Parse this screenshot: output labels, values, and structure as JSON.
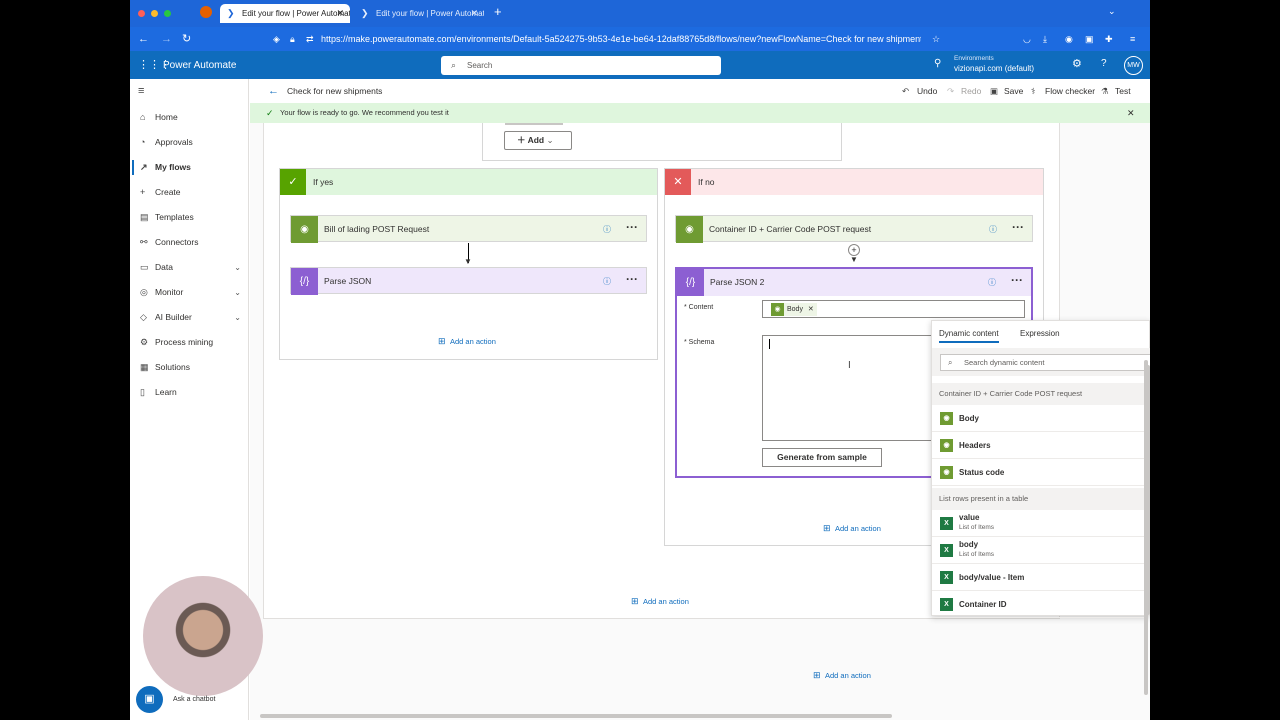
{
  "browser": {
    "tabs": [
      {
        "label": "Edit your flow | Power Automate",
        "active": true
      },
      {
        "label": "Edit your flow | Power Automate",
        "active": false
      }
    ],
    "new_tab": "+",
    "url": "https://make.powerautomate.com/environments/Default-5a524275-9b53-4e1e-be64-12daf88765d8/flows/new?newFlowName=Check for new shipments&"
  },
  "app": {
    "name": "Power Automate",
    "search_placeholder": "Search",
    "env_label": "Environments",
    "env_name": "vizionapi.com (default)",
    "avatar": "MW"
  },
  "sidebar": {
    "items": [
      {
        "label": "Home",
        "icon": "home-icon",
        "glyph": "⌂"
      },
      {
        "label": "Approvals",
        "icon": "approvals-icon",
        "glyph": "◔"
      },
      {
        "label": "My flows",
        "icon": "flows-icon",
        "glyph": "↗",
        "active": true
      },
      {
        "label": "Create",
        "icon": "plus-icon",
        "glyph": "+"
      },
      {
        "label": "Templates",
        "icon": "templates-icon",
        "glyph": "▤"
      },
      {
        "label": "Connectors",
        "icon": "connectors-icon",
        "glyph": "⚯"
      },
      {
        "label": "Data",
        "icon": "data-icon",
        "glyph": "▭",
        "chevron": true
      },
      {
        "label": "Monitor",
        "icon": "monitor-icon",
        "glyph": "◎",
        "chevron": true
      },
      {
        "label": "AI Builder",
        "icon": "ai-builder-icon",
        "glyph": "◇",
        "chevron": true
      },
      {
        "label": "Process mining",
        "icon": "process-mining-icon",
        "glyph": "⚙"
      },
      {
        "label": "Solutions",
        "icon": "solutions-icon",
        "glyph": "▦"
      },
      {
        "label": "Learn",
        "icon": "learn-icon",
        "glyph": "▯"
      }
    ]
  },
  "commandbar": {
    "flow_title": "Check for new shipments",
    "undo": "Undo",
    "redo": "Redo",
    "save": "Save",
    "flow_checker": "Flow checker",
    "test": "Test"
  },
  "banner": {
    "text": "Your flow is ready to go. We recommend you test it"
  },
  "flow": {
    "add_label": "Add",
    "if_yes": {
      "label": "If yes",
      "actions": [
        "Bill of lading POST Request",
        "Parse JSON"
      ],
      "add_action": "Add an action"
    },
    "if_no": {
      "label": "If no",
      "action1": "Container ID + Carrier Code POST request",
      "parse": {
        "title": "Parse JSON 2",
        "content_label": "* Content",
        "content_token": "Body",
        "schema_label": "* Schema",
        "generate": "Generate from sample"
      },
      "add_action": "Add an action"
    },
    "add_action_mid": "Add an action",
    "add_action_bottom": "Add an action"
  },
  "dynamic": {
    "tabs": [
      "Dynamic content",
      "Expression"
    ],
    "search_placeholder": "Search dynamic content",
    "section1": "Container ID + Carrier Code POST request",
    "section1_items": [
      "Body",
      "Headers",
      "Status code"
    ],
    "section2": "List rows present in a table",
    "section2_items": [
      {
        "label": "value",
        "sub": "List of Items"
      },
      {
        "label": "body",
        "sub": "List of Items"
      },
      {
        "label": "body/value - Item",
        "sub": ""
      },
      {
        "label": "Container ID",
        "sub": ""
      }
    ]
  },
  "chatbot": {
    "label": "Ask a chatbot"
  },
  "colors": {
    "brand": "#0f6cbd",
    "yes": "#dff6dd",
    "no": "#fde7e9",
    "http": "#6f9b32",
    "parse": "#8c5fd2",
    "excel": "#1f7a43"
  }
}
